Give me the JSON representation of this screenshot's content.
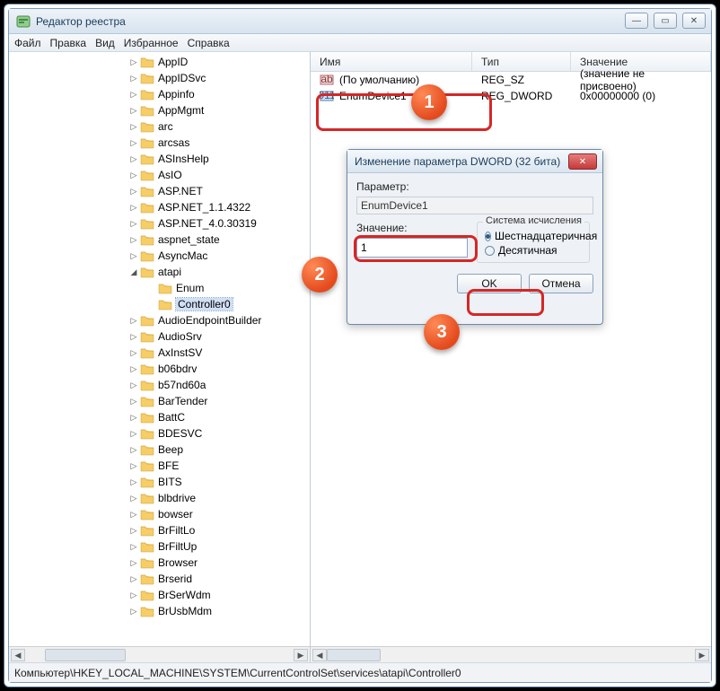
{
  "window": {
    "title": "Редактор реестра",
    "min_icon": "—",
    "max_icon": "▭",
    "close_icon": "✕"
  },
  "menu": {
    "file": "Файл",
    "edit": "Правка",
    "view": "Вид",
    "favorites": "Избранное",
    "help": "Справка"
  },
  "tree": {
    "items": [
      {
        "label": "AppID",
        "indent": 0,
        "exp": "▷"
      },
      {
        "label": "AppIDSvc",
        "indent": 0,
        "exp": "▷"
      },
      {
        "label": "Appinfo",
        "indent": 0,
        "exp": "▷"
      },
      {
        "label": "AppMgmt",
        "indent": 0,
        "exp": "▷"
      },
      {
        "label": "arc",
        "indent": 0,
        "exp": "▷"
      },
      {
        "label": "arcsas",
        "indent": 0,
        "exp": "▷"
      },
      {
        "label": "ASInsHelp",
        "indent": 0,
        "exp": "▷"
      },
      {
        "label": "AsIO",
        "indent": 0,
        "exp": "▷"
      },
      {
        "label": "ASP.NET",
        "indent": 0,
        "exp": "▷"
      },
      {
        "label": "ASP.NET_1.1.4322",
        "indent": 0,
        "exp": "▷"
      },
      {
        "label": "ASP.NET_4.0.30319",
        "indent": 0,
        "exp": "▷"
      },
      {
        "label": "aspnet_state",
        "indent": 0,
        "exp": "▷"
      },
      {
        "label": "AsyncMac",
        "indent": 0,
        "exp": "▷"
      },
      {
        "label": "atapi",
        "indent": 0,
        "exp": "◢"
      },
      {
        "label": "Enum",
        "indent": 1,
        "exp": ""
      },
      {
        "label": "Controller0",
        "indent": 1,
        "exp": "",
        "selected": true
      },
      {
        "label": "AudioEndpointBuilder",
        "indent": 0,
        "exp": "▷"
      },
      {
        "label": "AudioSrv",
        "indent": 0,
        "exp": "▷"
      },
      {
        "label": "AxInstSV",
        "indent": 0,
        "exp": "▷"
      },
      {
        "label": "b06bdrv",
        "indent": 0,
        "exp": "▷"
      },
      {
        "label": "b57nd60a",
        "indent": 0,
        "exp": "▷"
      },
      {
        "label": "BarTender",
        "indent": 0,
        "exp": "▷"
      },
      {
        "label": "BattC",
        "indent": 0,
        "exp": "▷"
      },
      {
        "label": "BDESVC",
        "indent": 0,
        "exp": "▷"
      },
      {
        "label": "Beep",
        "indent": 0,
        "exp": "▷"
      },
      {
        "label": "BFE",
        "indent": 0,
        "exp": "▷"
      },
      {
        "label": "BITS",
        "indent": 0,
        "exp": "▷"
      },
      {
        "label": "blbdrive",
        "indent": 0,
        "exp": "▷"
      },
      {
        "label": "bowser",
        "indent": 0,
        "exp": "▷"
      },
      {
        "label": "BrFiltLo",
        "indent": 0,
        "exp": "▷"
      },
      {
        "label": "BrFiltUp",
        "indent": 0,
        "exp": "▷"
      },
      {
        "label": "Browser",
        "indent": 0,
        "exp": "▷"
      },
      {
        "label": "Brserid",
        "indent": 0,
        "exp": "▷"
      },
      {
        "label": "BrSerWdm",
        "indent": 0,
        "exp": "▷"
      },
      {
        "label": "BrUsbMdm",
        "indent": 0,
        "exp": "▷"
      }
    ]
  },
  "list": {
    "hdr_name": "Имя",
    "hdr_type": "Тип",
    "hdr_value": "Значение",
    "rows": [
      {
        "icon": "sz",
        "name": "(По умолчанию)",
        "type": "REG_SZ",
        "value": "(значение не присвоено)"
      },
      {
        "icon": "dw",
        "name": "EnumDevice1",
        "type": "REG_DWORD",
        "value": "0x00000000 (0)"
      }
    ]
  },
  "dialog": {
    "title": "Изменение параметра DWORD (32 бита)",
    "param_label": "Параметр:",
    "param_value": "EnumDevice1",
    "value_label": "Значение:",
    "value_input": "1",
    "base_legend": "Система исчисления",
    "radio_hex": "Шестнадцатеричная",
    "radio_dec": "Десятичная",
    "ok": "OK",
    "cancel": "Отмена"
  },
  "status": {
    "path": "Компьютер\\HKEY_LOCAL_MACHINE\\SYSTEM\\CurrentControlSet\\services\\atapi\\Controller0"
  },
  "callouts": {
    "c1": "1",
    "c2": "2",
    "c3": "3"
  }
}
